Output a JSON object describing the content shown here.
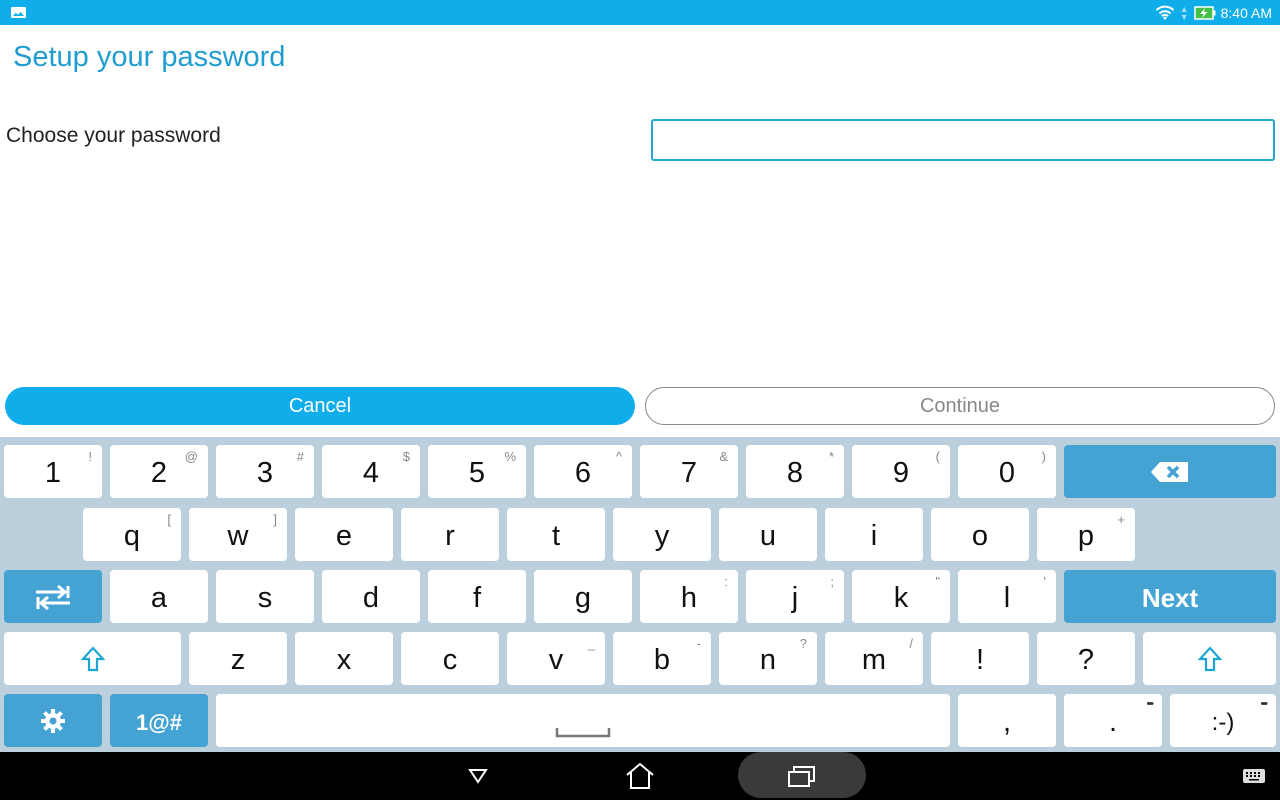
{
  "status_bar": {
    "left_icon": "gallery-icon",
    "icons": [
      "wifi-icon",
      "data-activity-icon",
      "battery-charging-icon"
    ],
    "time": "8:40 AM",
    "background_color": "#0fadea"
  },
  "header": {
    "title": "Setup your password",
    "title_color": "#1f9dd0"
  },
  "form": {
    "label": "Choose your password",
    "password_value": "",
    "password_placeholder": ""
  },
  "actions": {
    "cancel_label": "Cancel",
    "continue_label": "Continue",
    "continue_enabled": false,
    "accent_color": "#0fadea"
  },
  "keyboard": {
    "background_color": "#bccfdc",
    "function_key_color": "#45a3d4",
    "rows": [
      [
        {
          "main": "1",
          "hint": "!"
        },
        {
          "main": "2",
          "hint": "@"
        },
        {
          "main": "3",
          "hint": "#"
        },
        {
          "main": "4",
          "hint": "$"
        },
        {
          "main": "5",
          "hint": "%"
        },
        {
          "main": "6",
          "hint": "^"
        },
        {
          "main": "7",
          "hint": "&"
        },
        {
          "main": "8",
          "hint": "*"
        },
        {
          "main": "9",
          "hint": "("
        },
        {
          "main": "0",
          "hint": ")"
        },
        {
          "icon": "backspace-icon",
          "func": true
        }
      ],
      [
        {
          "main": "q",
          "hint": "["
        },
        {
          "main": "w",
          "hint": "]"
        },
        {
          "main": "e",
          "hint": ""
        },
        {
          "main": "r",
          "hint": ""
        },
        {
          "main": "t",
          "hint": ""
        },
        {
          "main": "y",
          "hint": ""
        },
        {
          "main": "u",
          "hint": ""
        },
        {
          "main": "i",
          "hint": ""
        },
        {
          "main": "o",
          "hint": ""
        },
        {
          "main": "p",
          "hint": "+"
        }
      ],
      [
        {
          "icon": "tab-switch-icon",
          "func": true
        },
        {
          "main": "a",
          "hint": ""
        },
        {
          "main": "s",
          "hint": ""
        },
        {
          "main": "d",
          "hint": ""
        },
        {
          "main": "f",
          "hint": ""
        },
        {
          "main": "g",
          "hint": ""
        },
        {
          "main": "h",
          "hint": ":"
        },
        {
          "main": "j",
          "hint": ";"
        },
        {
          "main": "k",
          "hint": "\""
        },
        {
          "main": "l",
          "hint": "'"
        },
        {
          "main": "Next",
          "func": true
        }
      ],
      [
        {
          "icon": "shift-icon"
        },
        {
          "main": "z",
          "hint": ""
        },
        {
          "main": "x",
          "hint": ""
        },
        {
          "main": "c",
          "hint": ""
        },
        {
          "main": "v",
          "hint": "_"
        },
        {
          "main": "b",
          "hint": "-"
        },
        {
          "main": "n",
          "hint": "?"
        },
        {
          "main": "m",
          "hint": "/"
        },
        {
          "main": "!",
          "hint": ""
        },
        {
          "main": "?",
          "hint": ""
        },
        {
          "icon": "shift-icon"
        }
      ],
      [
        {
          "icon": "settings-icon",
          "func": true
        },
        {
          "main": "1@#",
          "func": true
        },
        {
          "icon": "space-icon"
        },
        {
          "main": ",",
          "hint": ""
        },
        {
          "main": ".",
          "hint": "•••"
        },
        {
          "main": ":-)",
          "hint": "•••"
        }
      ]
    ]
  },
  "nav_bar": {
    "buttons": [
      "back-icon",
      "home-icon",
      "recents-icon"
    ],
    "right_icon": "keyboard-icon"
  }
}
